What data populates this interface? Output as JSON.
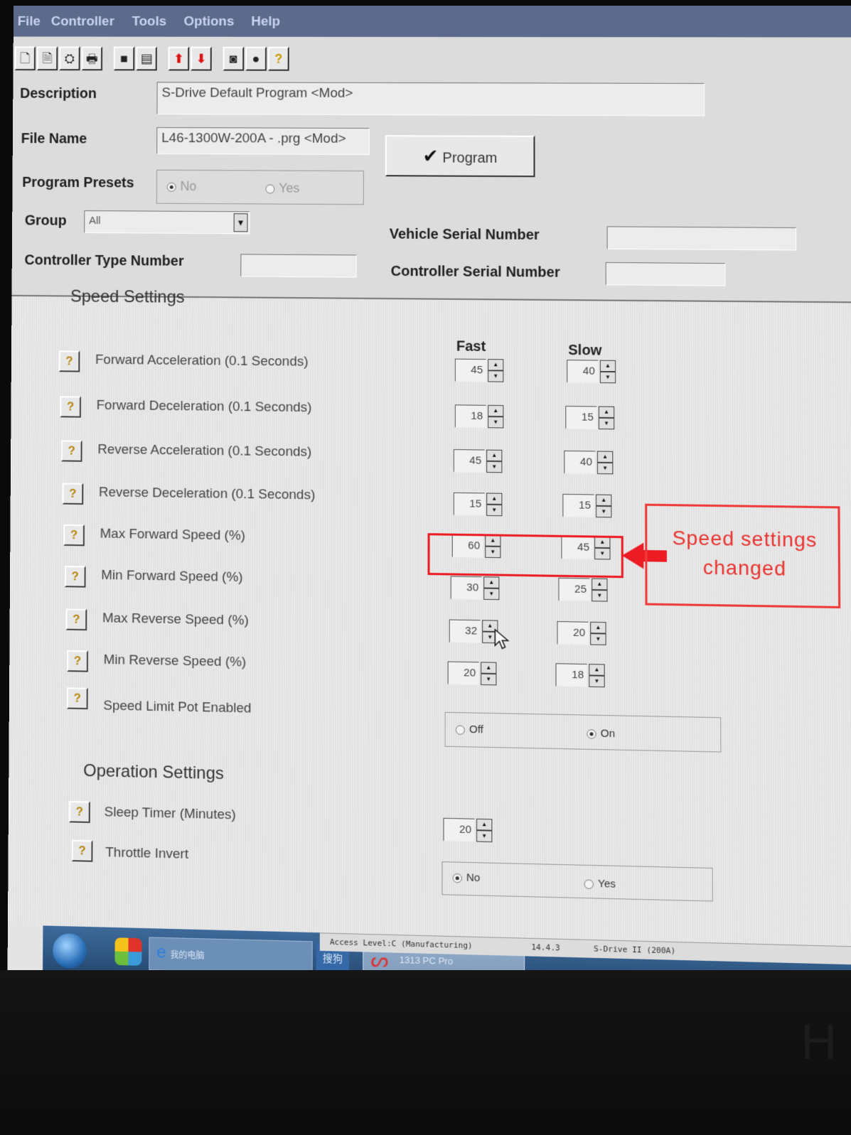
{
  "menu": [
    "File",
    "Controller",
    "Tools",
    "Options",
    "Help"
  ],
  "toolbar": {
    "icons": [
      "new-file-icon",
      "open-file-icon",
      "print-preview-icon",
      "print-icon",
      "save-icon",
      "save-as-icon",
      "read-arrow-up-icon",
      "write-arrow-down-icon",
      "monitor-icon",
      "lock-icon",
      "help-icon"
    ],
    "glyphs": [
      "🗋",
      "🗎",
      "⛭",
      "🖶",
      "■",
      "▤",
      "⬆",
      "⬇",
      "◙",
      "●",
      "?"
    ]
  },
  "header": {
    "description_label": "Description",
    "description_value": "S-Drive Default Program <Mod>",
    "filename_label": "File Name",
    "filename_value": "L46-1300W-200A - .prg <Mod>",
    "program_button": "Program",
    "presets_label": "Program Presets",
    "presets_no": "No",
    "presets_yes": "Yes",
    "group_label": "Group",
    "group_value": "All",
    "controller_type_label": "Controller Type Number",
    "controller_type_value": "",
    "vehicle_serial_label": "Vehicle Serial Number",
    "vehicle_serial_value": "",
    "controller_serial_label": "Controller Serial Number",
    "controller_serial_value": ""
  },
  "speed": {
    "title": "Speed Settings",
    "col_fast": "Fast",
    "col_slow": "Slow",
    "rows": [
      {
        "label": "Forward Acceleration (0.1 Seconds)",
        "fast": "45",
        "slow": "40"
      },
      {
        "label": "Forward Deceleration (0.1 Seconds)",
        "fast": "18",
        "slow": "15"
      },
      {
        "label": "Reverse Acceleration (0.1 Seconds)",
        "fast": "45",
        "slow": "40"
      },
      {
        "label": "Reverse Deceleration (0.1 Seconds)",
        "fast": "15",
        "slow": "15"
      },
      {
        "label": "Max Forward Speed (%)",
        "fast": "60",
        "slow": "45"
      },
      {
        "label": "Min Forward Speed (%)",
        "fast": "30",
        "slow": "25"
      },
      {
        "label": "Max Reverse Speed (%)",
        "fast": "32",
        "slow": "20"
      },
      {
        "label": "Min Reverse Speed (%)",
        "fast": "20",
        "slow": "18"
      }
    ],
    "pot_label": "Speed Limit Pot Enabled",
    "pot_off": "Off",
    "pot_on": "On"
  },
  "operation": {
    "title": "Operation Settings",
    "sleep_label": "Sleep Timer (Minutes)",
    "sleep_value": "20",
    "throttle_label": "Throttle Invert",
    "throttle_no": "No",
    "throttle_yes": "Yes"
  },
  "annotation": {
    "line1": "Speed settings",
    "line2": "changed",
    "color": "#ec1c24"
  },
  "status": {
    "access": "Access Level:C (Manufacturing)",
    "version": "14.4.3",
    "device": "S-Drive II (200A)"
  },
  "taskbar": {
    "ie_label": "e",
    "ie_text": "我的电脑",
    "ime": "搜狗",
    "active_task": "1313 PC Pro"
  },
  "colors": {
    "menubar": "#5c6a8c",
    "taskbar": "#2f5b8a",
    "annotation": "#ec1c24"
  }
}
